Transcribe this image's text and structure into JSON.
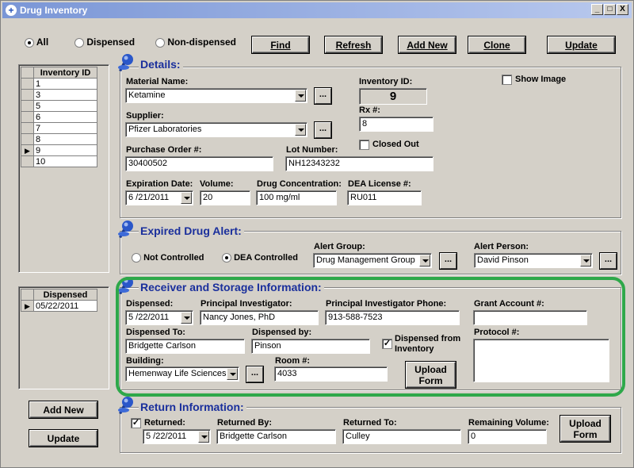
{
  "window": {
    "title": "Drug Inventory",
    "controls": [
      "_",
      "□",
      "X"
    ]
  },
  "filters": {
    "all": "All",
    "dispensed": "Dispensed",
    "non_dispensed": "Non-dispensed",
    "selected": "All"
  },
  "toolbar": {
    "find": "Find",
    "refresh": "Refresh",
    "add_new": "Add New",
    "clone": "Clone",
    "update": "Update"
  },
  "inventory_list": {
    "header": "Inventory ID",
    "rows": [
      "1",
      "3",
      "5",
      "6",
      "7",
      "8",
      "9",
      "10"
    ],
    "selected": "9"
  },
  "dispensed_list": {
    "header": "Dispensed",
    "rows": [
      "05/22/2011"
    ]
  },
  "left_buttons": {
    "add_new": "Add New",
    "update": "Update"
  },
  "details": {
    "title": "Details:",
    "material_name_label": "Material Name:",
    "material_name": "Ketamine",
    "inventory_id_label": "Inventory ID:",
    "inventory_id": "9",
    "show_image": "Show Image",
    "supplier_label": "Supplier:",
    "supplier": "Pfizer Laboratories",
    "rx_label": "Rx #:",
    "rx": "8",
    "closed_out": "Closed Out",
    "po_label": "Purchase Order #:",
    "po": "30400502",
    "lot_label": "Lot Number:",
    "lot": "NH12343232",
    "exp_label": "Expiration Date:",
    "exp": "6 /21/2011",
    "volume_label": "Volume:",
    "volume": "20",
    "conc_label": "Drug Concentration:",
    "conc": "100 mg/ml",
    "dea_label": "DEA License #:",
    "dea": "RU011",
    "ellipsis": "..."
  },
  "alert": {
    "title": "Expired Drug Alert:",
    "not_controlled": "Not Controlled",
    "dea_controlled": "DEA Controlled",
    "group_label": "Alert Group:",
    "group": "Drug Management Group",
    "person_label": "Alert Person:",
    "person": "David Pinson"
  },
  "receiver": {
    "title": "Receiver and Storage Information:",
    "dispensed_label": "Dispensed:",
    "dispensed": "5 /22/2011",
    "pi_label": "Principal Investigator:",
    "pi": "Nancy Jones, PhD",
    "pi_phone_label": "Principal Investigator Phone:",
    "pi_phone": "913-588-7523",
    "grant_label": "Grant Account #:",
    "grant": "",
    "disp_to_label": "Dispensed To:",
    "disp_to": "Bridgette Carlson",
    "disp_by_label": "Dispensed by:",
    "disp_by": "Pinson",
    "from_inv_1": "Dispensed from",
    "from_inv_2": "Inventory",
    "protocol_label": "Protocol #:",
    "building_label": "Building:",
    "building": "Hemenway Life Sciences",
    "room_label": "Room #:",
    "room": "4033",
    "upload_1": "Upload",
    "upload_2": "Form"
  },
  "return": {
    "title": "Return Information:",
    "returned_label": "Returned:",
    "returned": "5 /22/2011",
    "returned_by_label": "Returned By:",
    "returned_by": "Bridgette Carlson",
    "returned_to_label": "Returned To:",
    "returned_to": "Culley",
    "remaining_label": "Remaining Volume:",
    "remaining": "0",
    "upload_1": "Upload",
    "upload_2": "Form"
  },
  "colors": {
    "section_title": "#1a2f9c",
    "highlight": "#2ea84a",
    "window_bg": "#d4d0c8"
  }
}
